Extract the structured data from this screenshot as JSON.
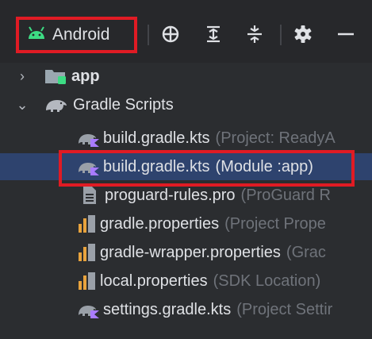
{
  "toolbar": {
    "view_label": "Android",
    "icons": [
      "android-icon",
      "locate-icon",
      "expand-all-icon",
      "collapse-all-icon",
      "gear-icon",
      "minimize-icon"
    ]
  },
  "tree": {
    "app": {
      "label": "app"
    },
    "gradle_scripts": {
      "label": "Gradle Scripts"
    },
    "items": [
      {
        "name": "build.gradle.kts",
        "hint": "(Project: ReadyA",
        "icon": "gradle-kotlin-icon"
      },
      {
        "name": "build.gradle.kts",
        "hint": "(Module :app)",
        "icon": "gradle-kotlin-icon",
        "selected": true
      },
      {
        "name": "proguard-rules.pro",
        "hint": "(ProGuard R",
        "icon": "text-file-icon"
      },
      {
        "name": "gradle.properties",
        "hint": "(Project Prope",
        "icon": "properties-file-icon"
      },
      {
        "name": "gradle-wrapper.properties",
        "hint": "(Grac",
        "icon": "properties-file-icon"
      },
      {
        "name": "local.properties",
        "hint": "(SDK Location)",
        "icon": "properties-file-icon"
      },
      {
        "name": "settings.gradle.kts",
        "hint": "(Project Settir",
        "icon": "gradle-kotlin-icon"
      }
    ]
  },
  "colors": {
    "highlight": "#e01b24",
    "selection": "#2e436e",
    "android_green": "#3ddc84"
  }
}
